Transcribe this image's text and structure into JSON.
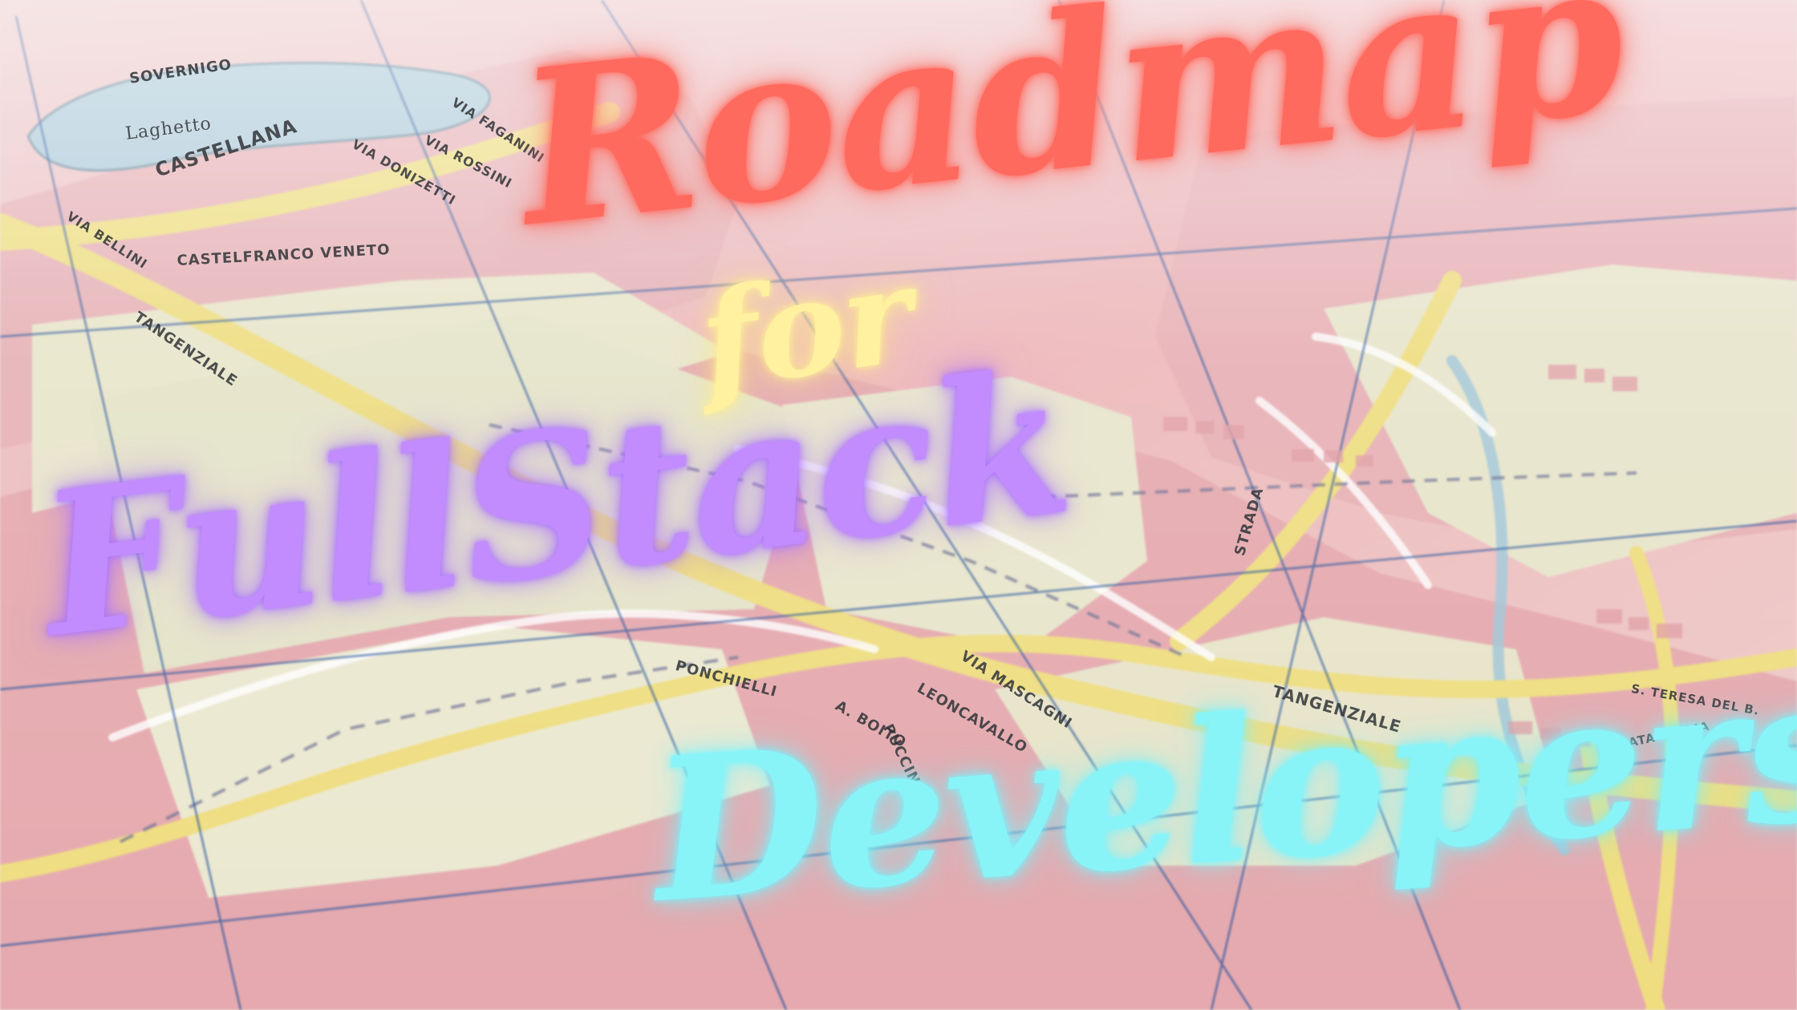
{
  "headline": {
    "line1": "Roadmap",
    "line2": "for",
    "line3": "FullStack",
    "line4": "Developers"
  },
  "map_labels": [
    "SOVERNIGO",
    "Laghetto",
    "CASTELLANA",
    "VIA DONIZETTI",
    "VIA FAGANINI",
    "VIA ROSSINI",
    "VIA BELLINI",
    "CASTELFRANCO VENETO",
    "TANGENZIALE",
    "VIA MASCAGNI",
    "LEONCAVALLO",
    "PONCHIELLI",
    "A. BOITO",
    "PUCCINI",
    "STRADA",
    "TANGENZIALE",
    "S. TERESA DEL B.",
    "BEATA GIULIA"
  ],
  "colors": {
    "roadmap": "#ff6a5f",
    "for": "#fff1a0",
    "fullstack": "#c28cff",
    "developers": "#89f4f8",
    "map_pink": "#e7a7ae",
    "map_cream": "#e8e5c9",
    "map_road": "#f0dd7a",
    "map_water": "#a8c8db"
  }
}
